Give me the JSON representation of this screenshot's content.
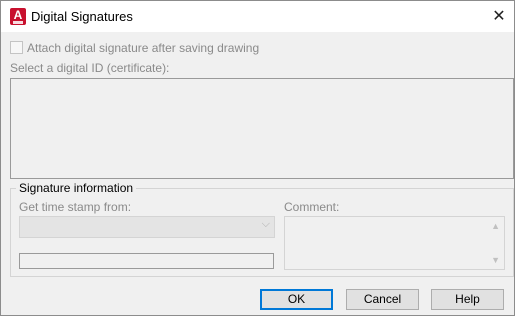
{
  "window": {
    "title": "Digital Signatures",
    "app_icon_letter": "A"
  },
  "attach_checkbox": {
    "label": "Attach digital signature after saving drawing",
    "checked": false
  },
  "certificate": {
    "label": "Select a digital ID (certificate):",
    "items": []
  },
  "signature_info": {
    "group_title": "Signature information",
    "timestamp_label": "Get time stamp from:",
    "timestamp_value": "",
    "comment_label": "Comment:",
    "comment_value": ""
  },
  "buttons": {
    "ok": "OK",
    "cancel": "Cancel",
    "help": "Help"
  },
  "colors": {
    "accent": "#0078d7",
    "app_icon": "#c8102e"
  }
}
